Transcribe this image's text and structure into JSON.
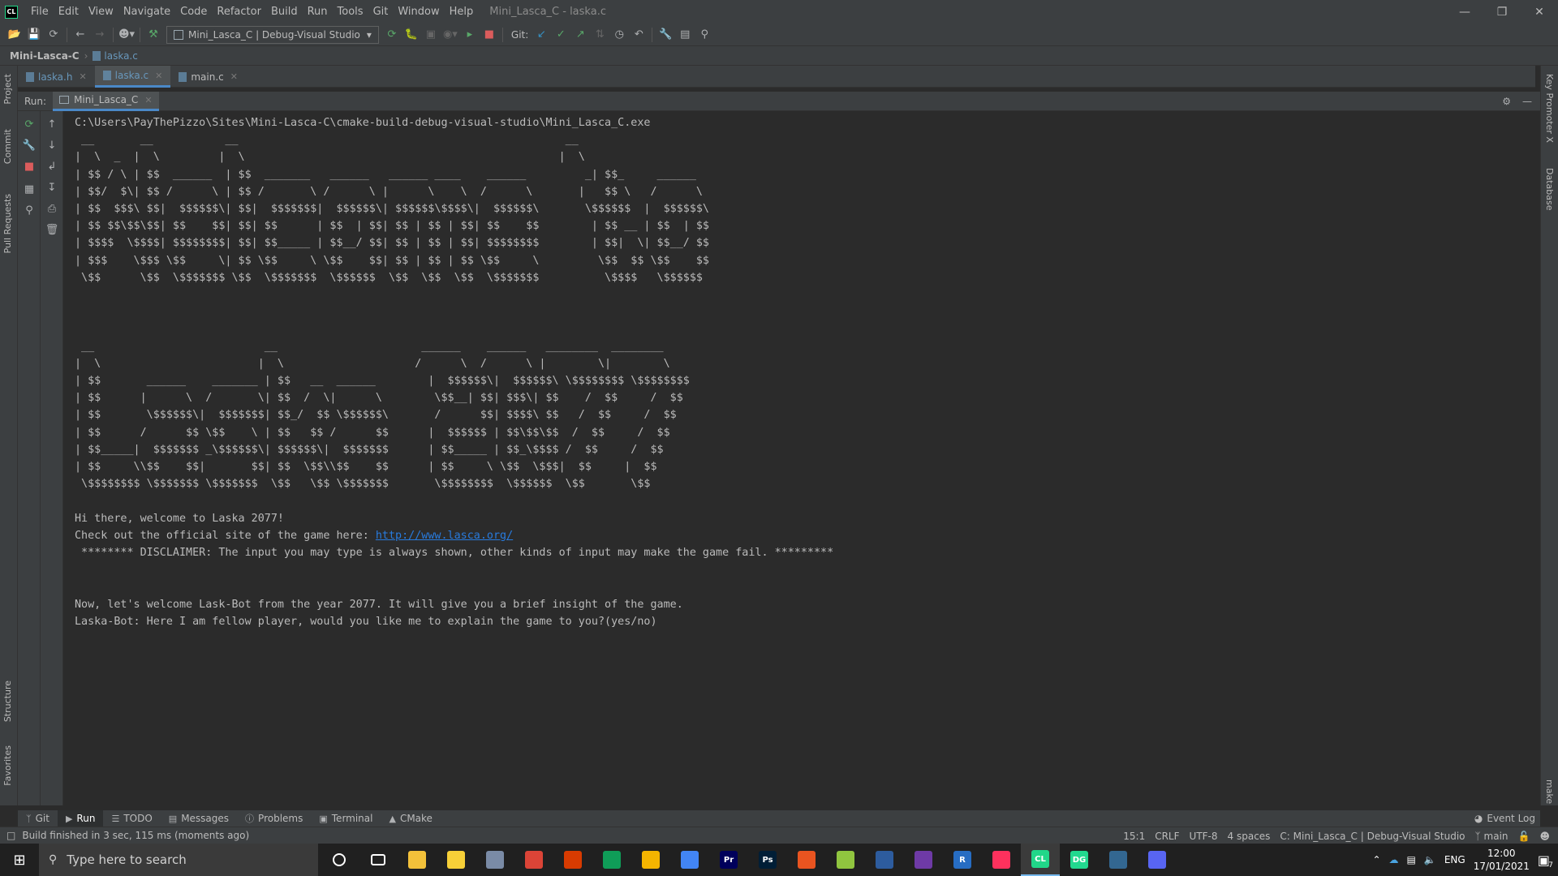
{
  "titlebar": {
    "logo": "CL",
    "menu": [
      "File",
      "Edit",
      "View",
      "Navigate",
      "Code",
      "Refactor",
      "Build",
      "Run",
      "Tools",
      "Git",
      "Window",
      "Help"
    ],
    "window_title": "Mini_Lasca_C - laska.c",
    "controls": [
      "minimize-icon",
      "restore-icon",
      "close-icon"
    ]
  },
  "toolbar": {
    "run_config": "Mini_Lasca_C | Debug-Visual Studio",
    "git_label": "Git:"
  },
  "navbar": {
    "project": "Mini-Lasca-C",
    "file": "laska.c"
  },
  "editor_tabs": [
    {
      "label": "laska.h"
    },
    {
      "label": "laska.c"
    },
    {
      "label": "main.c"
    }
  ],
  "left_stripe": [
    "Project",
    "Commit",
    "Pull Requests",
    "Structure",
    "Favorites"
  ],
  "right_stripe": [
    "Key Promoter X",
    "Database",
    "make"
  ],
  "run_panel": {
    "label": "Run:",
    "tab": "Mini_Lasca_C"
  },
  "console": {
    "path": "C:\\Users\\PayThePizzo\\Sites\\Mini-Lasca-C\\cmake-build-debug-visual-studio\\Mini_Lasca_C.exe",
    "banner1": " __       __           __                                                  __\n|  \\  _  |  \\         |  \\                                                |  \\\n| $$ / \\ | $$  ______  | $$  _______   ______   ______ ____    ______         _| $$_     ______\n| $$/  $\\| $$ /      \\ | $$ /       \\ /      \\ |      \\    \\  /      \\       |   $$ \\   /      \\\n| $$  $$$\\ $$|  $$$$$$\\| $$|  $$$$$$$|  $$$$$$\\| $$$$$$\\$$$$\\|  $$$$$$\\       \\$$$$$$  |  $$$$$$\\\n| $$ $$\\$$\\$$| $$    $$| $$| $$      | $$  | $$| $$ | $$ | $$| $$    $$        | $$ __ | $$  | $$\n| $$$$  \\$$$$| $$$$$$$$| $$| $$_____ | $$__/ $$| $$ | $$ | $$| $$$$$$$$        | $$|  \\| $$__/ $$\n| $$$    \\$$$ \\$$     \\| $$ \\$$     \\ \\$$    $$| $$ | $$ | $$ \\$$     \\         \\$$  $$ \\$$    $$\n \\$$      \\$$  \\$$$$$$$ \\$$  \\$$$$$$$  \\$$$$$$  \\$$  \\$$  \\$$  \\$$$$$$$          \\$$$$   \\$$$$$$",
    "banner2": " __                          __                      ______    ______   ________  ________\n|  \\                        |  \\                    /      \\  /      \\ |        \\|        \\\n| $$       ______    _______ | $$   __  ______        |  $$$$$$\\|  $$$$$$\\ \\$$$$$$$$ \\$$$$$$$$\n| $$      |      \\  /       \\| $$  /  \\|      \\        \\$$__| $$| $$$\\| $$    /  $$     /  $$\n| $$       \\$$$$$$\\|  $$$$$$$| $$_/  $$ \\$$$$$$\\       /      $$| $$$$\\ $$   /  $$     /  $$\n| $$      /      $$ \\$$    \\ | $$   $$ /      $$      |  $$$$$$ | $$\\$$\\$$  /  $$     /  $$\n| $$_____|  $$$$$$$ _\\$$$$$$\\| $$$$$$\\|  $$$$$$$      | $$_____ | $$_\\$$$$ /  $$     /  $$\n| $$     \\\\$$    $$|       $$| $$  \\$$\\\\$$    $$      | $$     \\ \\$$  \\$$$|  $$     |  $$\n \\$$$$$$$$ \\$$$$$$$ \\$$$$$$$  \\$$   \\$$ \\$$$$$$$       \\$$$$$$$$  \\$$$$$$  \\$$       \\$$",
    "welcome": "Hi there, welcome to Laska 2077!",
    "site_prefix": "Check out the official site of the game here: ",
    "site_link": "http://www.lasca.org/",
    "disclaimer": " ******** DISCLAIMER: The input you may type is always shown, other kinds of input may make the game fail. *********",
    "intro": "Now, let's welcome Lask-Bot from the year 2077. It will give you a brief insight of the game.",
    "question": "Laska-Bot: Here I am fellow player, would you like me to explain the game to you?(yes/no)"
  },
  "bottom_tabs": [
    {
      "label": "Git",
      "icon": "git-branch-icon"
    },
    {
      "label": "Run",
      "icon": "play-icon"
    },
    {
      "label": "TODO",
      "icon": "list-icon"
    },
    {
      "label": "Messages",
      "icon": "messages-icon"
    },
    {
      "label": "Problems",
      "icon": "info-icon"
    },
    {
      "label": "Terminal",
      "icon": "terminal-icon"
    },
    {
      "label": "CMake",
      "icon": "cmake-icon"
    }
  ],
  "event_log": "Event Log",
  "statusbar": {
    "build_message": "Build finished in 3 sec, 115 ms (moments ago)",
    "position": "15:1",
    "line_ending": "CRLF",
    "encoding": "UTF-8",
    "indent": "4 spaces",
    "context": "C: Mini_Lasca_C | Debug-Visual Studio",
    "branch": "main"
  },
  "taskbar": {
    "search_placeholder": "Type here to search",
    "apps": [
      {
        "name": "cortana-icon",
        "label": "",
        "color": "#202020"
      },
      {
        "name": "task-view-icon",
        "label": "",
        "color": "#202020"
      },
      {
        "name": "file-explorer-icon",
        "label": "",
        "color": "#f3c13a"
      },
      {
        "name": "sticky-notes-icon",
        "label": "",
        "color": "#f7d038"
      },
      {
        "name": "mail-icon",
        "label": "",
        "color": "#7a8ba6"
      },
      {
        "name": "chrome-icon",
        "label": "",
        "color": "#db4437"
      },
      {
        "name": "office-icon",
        "label": "",
        "color": "#d83b01"
      },
      {
        "name": "sheets-icon",
        "label": "",
        "color": "#0f9d58"
      },
      {
        "name": "slides-icon",
        "label": "",
        "color": "#f4b400"
      },
      {
        "name": "docs-icon",
        "label": "",
        "color": "#4285f4"
      },
      {
        "name": "premiere-icon",
        "label": "Pr",
        "color": "#00005b"
      },
      {
        "name": "photoshop-icon",
        "label": "Ps",
        "color": "#001e36"
      },
      {
        "name": "ubuntu-icon",
        "label": "",
        "color": "#e95420"
      },
      {
        "name": "notepad-plus-icon",
        "label": "",
        "color": "#90c53f"
      },
      {
        "name": "powershell-icon",
        "label": "",
        "color": "#2d5c9e"
      },
      {
        "name": "obs-icon",
        "label": "",
        "color": "#6e3aa6"
      },
      {
        "name": "r-icon",
        "label": "R",
        "color": "#276dc3"
      },
      {
        "name": "intellij-icon",
        "label": "",
        "color": "#fe315d"
      },
      {
        "name": "clion-icon",
        "label": "CL",
        "color": "#21d789"
      },
      {
        "name": "datagrip-icon",
        "label": "DG",
        "color": "#22d88f"
      },
      {
        "name": "postgres-icon",
        "label": "",
        "color": "#336791"
      },
      {
        "name": "discord-icon",
        "label": "",
        "color": "#5865f2"
      }
    ],
    "language": "ENG",
    "time": "12:00",
    "date": "17/01/2021",
    "notifications": "7"
  }
}
